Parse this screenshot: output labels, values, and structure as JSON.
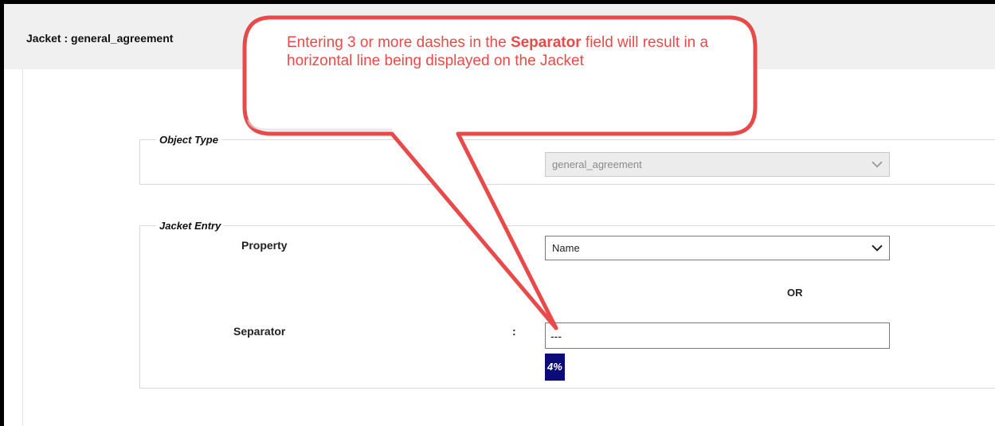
{
  "page": {
    "title": "Jacket : general_agreement"
  },
  "callout": {
    "text_before": "Entering 3 or more dashes in the ",
    "text_bold": "Separator",
    "text_after": " field will result in a horizontal line being displayed on the Jacket",
    "color": "#e84a4a"
  },
  "object_type": {
    "legend": "Object Type",
    "select_value": "general_agreement",
    "disabled": true
  },
  "jacket_entry": {
    "legend": "Jacket Entry",
    "property_label": "Property",
    "property_value": "Name",
    "or_label": "OR",
    "separator_label": "Separator",
    "separator_colon": ":",
    "separator_value": "---",
    "progress_label": "4%",
    "progress_percent": 4
  },
  "icons": {
    "dropdown": "chevron-down-icon"
  },
  "colors": {
    "badge_bg": "#0b0b7a",
    "header_bg": "#f0f0f0"
  }
}
